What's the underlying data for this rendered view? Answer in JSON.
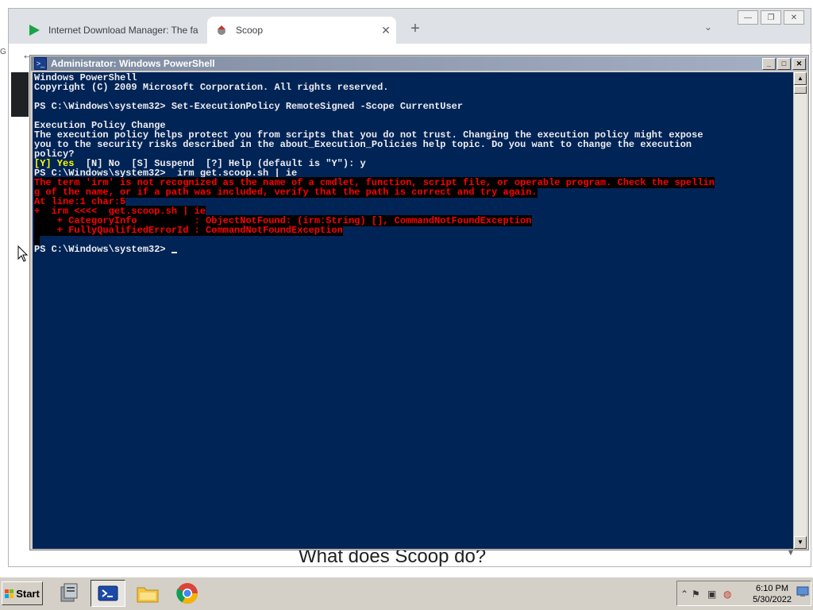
{
  "browser": {
    "tabs": [
      {
        "label": "Internet Download Manager: The fa",
        "icon": "play-icon",
        "active": false
      },
      {
        "label": "Scoop",
        "icon": "scoop-icon",
        "active": true
      }
    ],
    "new_tab_label": "+",
    "page_heading": "What does Scoop do?",
    "side_glyph": "G"
  },
  "powershell": {
    "title": "Administrator: Windows PowerShell",
    "lines": [
      {
        "text": "Windows PowerShell",
        "kind": "normal"
      },
      {
        "text": "Copyright (C) 2009 Microsoft Corporation. All rights reserved.",
        "kind": "normal"
      },
      {
        "text": "",
        "kind": "normal"
      },
      {
        "text": "PS C:\\Windows\\system32> Set-ExecutionPolicy RemoteSigned -Scope CurrentUser",
        "kind": "normal"
      },
      {
        "text": "",
        "kind": "normal"
      },
      {
        "text": "Execution Policy Change",
        "kind": "normal"
      },
      {
        "text": "The execution policy helps protect you from scripts that you do not trust. Changing the execution policy might expose",
        "kind": "normal"
      },
      {
        "text": "you to the security risks described in the about_Execution_Policies help topic. Do you want to change the execution",
        "kind": "normal"
      },
      {
        "text": "policy?",
        "kind": "normal"
      },
      {
        "text": "[Y] Yes  [N] No  [S] Suspend  [?] Help (default is \"Y\"): y",
        "kind": "prompt"
      },
      {
        "text": "PS C:\\Windows\\system32>  irm get.scoop.sh | ie",
        "kind": "normal"
      },
      {
        "text": "The term 'irm' is not recognized as the name of a cmdlet, function, script file, or operable program. Check the spellin",
        "kind": "error"
      },
      {
        "text": "g of the name, or if a path was included, verify that the path is correct and try again.",
        "kind": "error"
      },
      {
        "text": "At line:1 char:5",
        "kind": "error"
      },
      {
        "text": "+  irm <<<<  get.scoop.sh | ie",
        "kind": "error"
      },
      {
        "text": "    + CategoryInfo          : ObjectNotFound: (irm:String) [], CommandNotFoundException",
        "kind": "error"
      },
      {
        "text": "    + FullyQualifiedErrorId : CommandNotFoundException",
        "kind": "error"
      },
      {
        "text": " ",
        "kind": "error"
      },
      {
        "text": "PS C:\\Windows\\system32> ",
        "kind": "cursor"
      }
    ]
  },
  "taskbar": {
    "start_label": "Start",
    "clock_time": "6:10 PM",
    "clock_date": "5/30/2022"
  }
}
